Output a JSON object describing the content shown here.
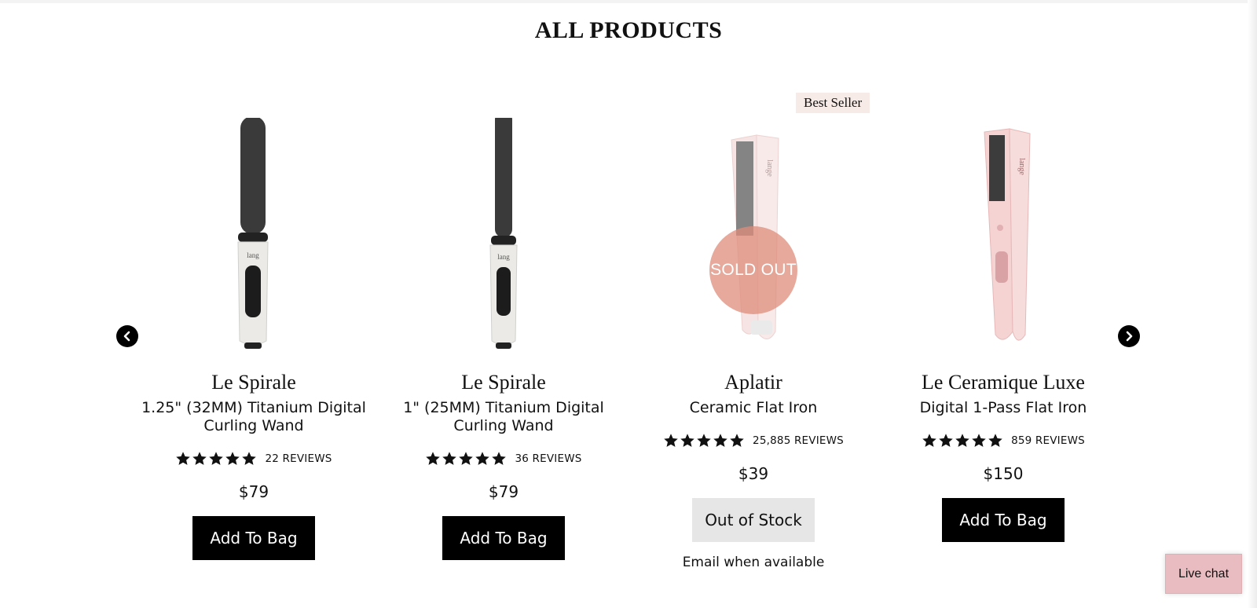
{
  "section": {
    "title": "ALL PRODUCTS"
  },
  "carousel": {
    "prev_icon": "chevron-left-icon",
    "next_icon": "chevron-right-icon"
  },
  "products": [
    {
      "name": "Le Spirale",
      "subtitle": "1.25\" (32MM) Titanium Digital Curling Wand",
      "rating": 5,
      "reviews": "22 REVIEWS",
      "price": "$79",
      "button_label": "Add To Bag",
      "image": "curling-wand-icon"
    },
    {
      "name": "Le Spirale",
      "subtitle": "1\" (25MM) Titanium Digital Curling Wand",
      "rating": 5,
      "reviews": "36 REVIEWS",
      "price": "$79",
      "button_label": "Add To Bag",
      "image": "curling-wand-icon"
    },
    {
      "badge": "Best Seller",
      "name": "Aplatir",
      "subtitle": "Ceramic Flat Iron",
      "rating": 5,
      "reviews": "25,885 REVIEWS",
      "price": "$39",
      "button_label": "Out of Stock",
      "sold_out_label": "SOLD OUT",
      "notify_label": "Email when available",
      "image": "flat-iron-icon"
    },
    {
      "name": "Le Ceramique Luxe",
      "subtitle": "Digital 1-Pass Flat Iron",
      "rating": 5,
      "reviews": "859 REVIEWS",
      "price": "$150",
      "button_label": "Add To Bag",
      "image": "flat-iron-icon"
    }
  ],
  "live_chat": {
    "label": "Live chat"
  },
  "colors": {
    "button": "#000000",
    "out_of_stock": "#e6e6e6",
    "sold_out_overlay": "#de8c7a",
    "badge": "#f6ebe6",
    "live_chat": "#e8bcc0"
  }
}
